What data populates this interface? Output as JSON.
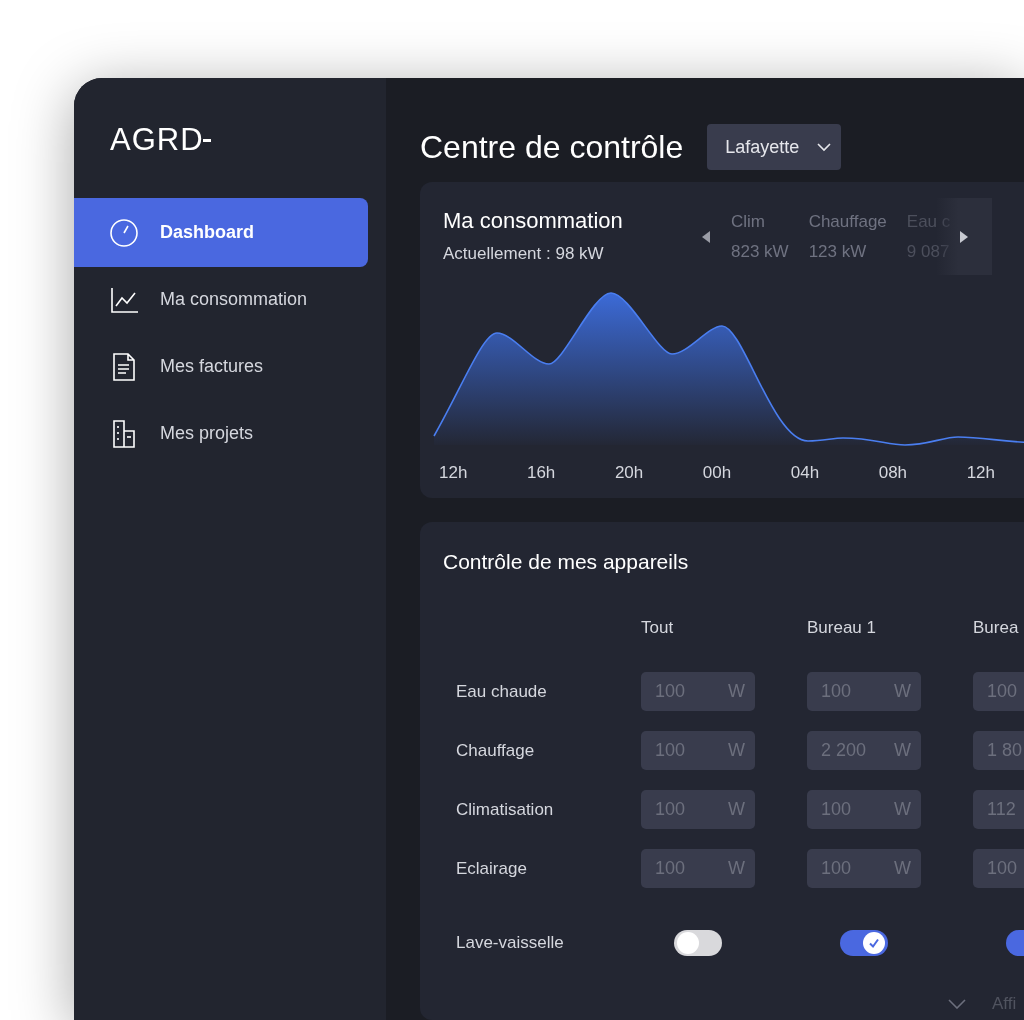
{
  "logo": "AGRD",
  "sidebar": {
    "items": [
      {
        "label": "Dashboard",
        "selected": true
      },
      {
        "label": "Ma consommation",
        "selected": false
      },
      {
        "label": "Mes factures",
        "selected": false
      },
      {
        "label": "Mes projets",
        "selected": false
      }
    ]
  },
  "header": {
    "title": "Centre de contrôle",
    "site_select": {
      "value": "Lafayette"
    }
  },
  "consumption": {
    "title": "Ma consommation",
    "current": "Actuellement : 98 kW",
    "breakdown": [
      {
        "label": "Clim",
        "value": "823 kW",
        "faded": false
      },
      {
        "label": "Chauffage",
        "value": "123 kW",
        "faded": false
      },
      {
        "label": "Eau c",
        "value": "9 087",
        "faded": true
      }
    ],
    "x_labels": [
      "12h",
      "16h",
      "20h",
      "00h",
      "04h",
      "08h",
      "12h"
    ]
  },
  "devices": {
    "title": "Contrôle de mes appareils",
    "columns": [
      "Tout",
      "Bureau 1",
      "Burea"
    ],
    "rows": [
      {
        "label": "Eau chaude",
        "kind": "power",
        "cells": [
          {
            "placeholder": "100",
            "unit": "W"
          },
          {
            "placeholder": "100",
            "unit": "W"
          },
          {
            "placeholder": "100"
          }
        ]
      },
      {
        "label": "Chauffage",
        "kind": "power",
        "cells": [
          {
            "placeholder": "100",
            "unit": "W"
          },
          {
            "placeholder": "2 200",
            "unit": "W"
          },
          {
            "placeholder": "1 80"
          }
        ]
      },
      {
        "label": "Climatisation",
        "kind": "power",
        "cells": [
          {
            "placeholder": "100",
            "unit": "W"
          },
          {
            "placeholder": "100",
            "unit": "W"
          },
          {
            "placeholder": "112"
          }
        ]
      },
      {
        "label": "Eclairage",
        "kind": "power",
        "cells": [
          {
            "placeholder": "100",
            "unit": "W"
          },
          {
            "placeholder": "100",
            "unit": "W"
          },
          {
            "placeholder": "100"
          }
        ]
      },
      {
        "label": "Lave-vaisselle",
        "kind": "toggle",
        "cells": [
          {
            "on": false
          },
          {
            "on": true
          },
          {
            "on": true
          }
        ]
      }
    ],
    "footer": {
      "label": "Affi"
    }
  }
}
